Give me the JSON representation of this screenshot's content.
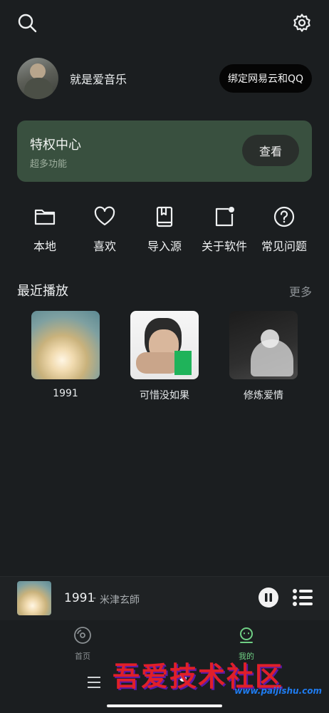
{
  "profile": {
    "username": "就是爱音乐",
    "bind_button": "绑定网易云和QQ"
  },
  "vip": {
    "title": "特权中心",
    "subtitle": "超多功能",
    "view_button": "查看"
  },
  "quick_actions": [
    {
      "label": "本地",
      "icon": "folder-icon"
    },
    {
      "label": "喜欢",
      "icon": "heart-icon"
    },
    {
      "label": "导入源",
      "icon": "book-icon"
    },
    {
      "label": "关于软件",
      "icon": "info-card-icon"
    },
    {
      "label": "常见问题",
      "icon": "help-icon"
    }
  ],
  "recent": {
    "title": "最近播放",
    "more": "更多",
    "albums": [
      {
        "name": "1991"
      },
      {
        "name": "可惜没如果"
      },
      {
        "name": "修炼爱情"
      }
    ]
  },
  "now_playing": {
    "title": "1991",
    "separator": "-",
    "artist": "米津玄師"
  },
  "bottom_nav": {
    "home": "首页",
    "mine": "我的"
  },
  "watermark": {
    "text": "吾爱技术社区",
    "url": "www.paijishu.com"
  },
  "colors": {
    "background": "#1b1e20",
    "vip_card": "#39503f",
    "active_tab": "#6fcf84"
  }
}
